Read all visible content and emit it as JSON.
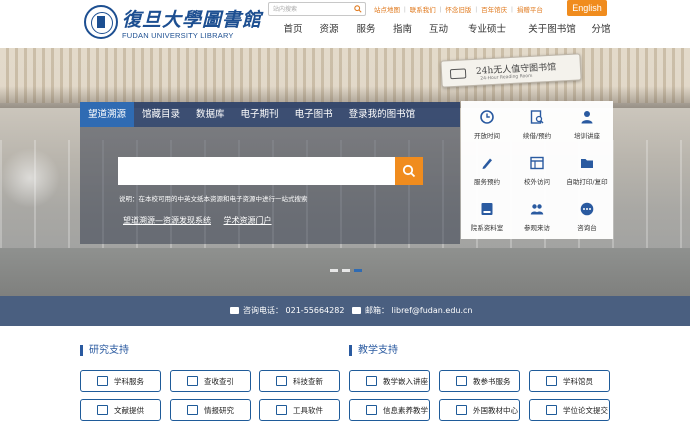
{
  "header": {
    "logo_cn": "復旦大學圖書館",
    "logo_en": "FUDAN UNIVERSITY LIBRARY",
    "search_placeholder": "站内搜索",
    "top_links": [
      "站点地图",
      "联系我们",
      "怀念旧版",
      "百年馆庆",
      "捐赠平台"
    ],
    "english_label": "English",
    "nav": [
      "首页",
      "资源",
      "服务",
      "指南",
      "互动",
      "专业硕士",
      "关于图书馆",
      "分馆"
    ]
  },
  "banner": {
    "sign_cn": "24h无人值守图书馆",
    "sign_en": "24-Hour Reading Room",
    "tabs": [
      "望道溯源",
      "馆藏目录",
      "数据库",
      "电子期刊",
      "电子图书",
      "登录我的图书馆"
    ],
    "active_tab": 0,
    "search_placeholder": "",
    "note": "说明：在本校可用的中英文纸本资源和电子资源中进行一站式搜索",
    "sublink_1": "望道溯源—资源发现系统",
    "sublink_2": "学术资源门户",
    "slide_count": 3,
    "active_slide": 2
  },
  "services": [
    {
      "label": "开放时间",
      "icon": "clock-icon"
    },
    {
      "label": "续借/预约",
      "icon": "document-search-icon"
    },
    {
      "label": "培训讲座",
      "icon": "person-icon"
    },
    {
      "label": "服务预约",
      "icon": "pencil-icon"
    },
    {
      "label": "校外访问",
      "icon": "window-icon"
    },
    {
      "label": "自助打印/复印",
      "icon": "folder-icon"
    },
    {
      "label": "院系资料室",
      "icon": "bookmark-icon"
    },
    {
      "label": "参观来访",
      "icon": "group-icon"
    },
    {
      "label": "咨询台",
      "icon": "chat-icon"
    }
  ],
  "contact": {
    "phone": "咨询电话：  021-55664282",
    "email": "邮箱：  libref@fudan.edu.cn"
  },
  "research": {
    "title": "研究支持",
    "buttons": [
      "学科服务",
      "查收查引",
      "科技查新",
      "文献提供",
      "情报研究",
      "工具软件"
    ]
  },
  "teaching": {
    "title": "教学支持",
    "buttons": [
      "教学嵌入讲座",
      "教参书服务",
      "学科馆员",
      "信息素养教学",
      "外国教材中心",
      "学位论文提交"
    ]
  },
  "colors": {
    "brand_blue": "#1d4f91",
    "accent_orange": "#f08c1e",
    "tab_active": "#2f6bb3",
    "contact_bar": "#4a5f80"
  }
}
